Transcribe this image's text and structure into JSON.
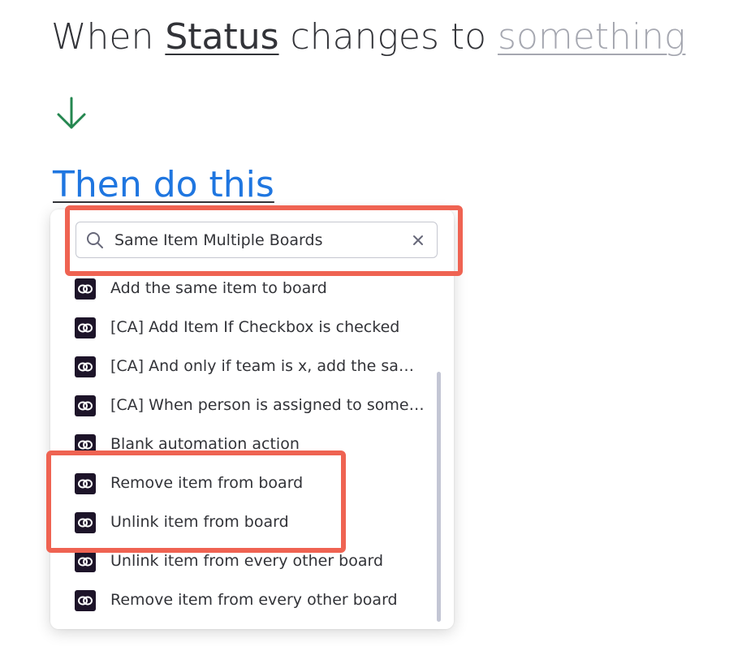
{
  "trigger": {
    "prefix": "When ",
    "field": "Status",
    "middle": " changes to ",
    "value_placeholder": "something"
  },
  "action_header": "Then do this",
  "search": {
    "value": "Same Item Multiple Boards",
    "clear_icon": "close-icon"
  },
  "results": [
    {
      "label": "Add the same item to board",
      "icon": "app-logo-icon"
    },
    {
      "label": "[CA] Add Item If Checkbox is checked",
      "icon": "app-logo-icon"
    },
    {
      "label": "[CA] And only if team is x, add the same...",
      "icon": "app-logo-icon"
    },
    {
      "label": "[CA] When person is assigned to someo...",
      "icon": "app-logo-icon"
    },
    {
      "label": "Blank automation action",
      "icon": "app-logo-icon"
    },
    {
      "label": "Remove item from board",
      "icon": "app-logo-icon"
    },
    {
      "label": "Unlink item from board",
      "icon": "app-logo-icon"
    },
    {
      "label": "Unlink item from every other board",
      "icon": "app-logo-icon"
    },
    {
      "label": "Remove item from every other board",
      "icon": "app-logo-icon"
    }
  ],
  "colors": {
    "text": "#323338",
    "link_blue": "#1f76e0",
    "arrow_green": "#258750",
    "highlight_red": "#ef6352",
    "app_logo_bg": "#1d1429"
  }
}
